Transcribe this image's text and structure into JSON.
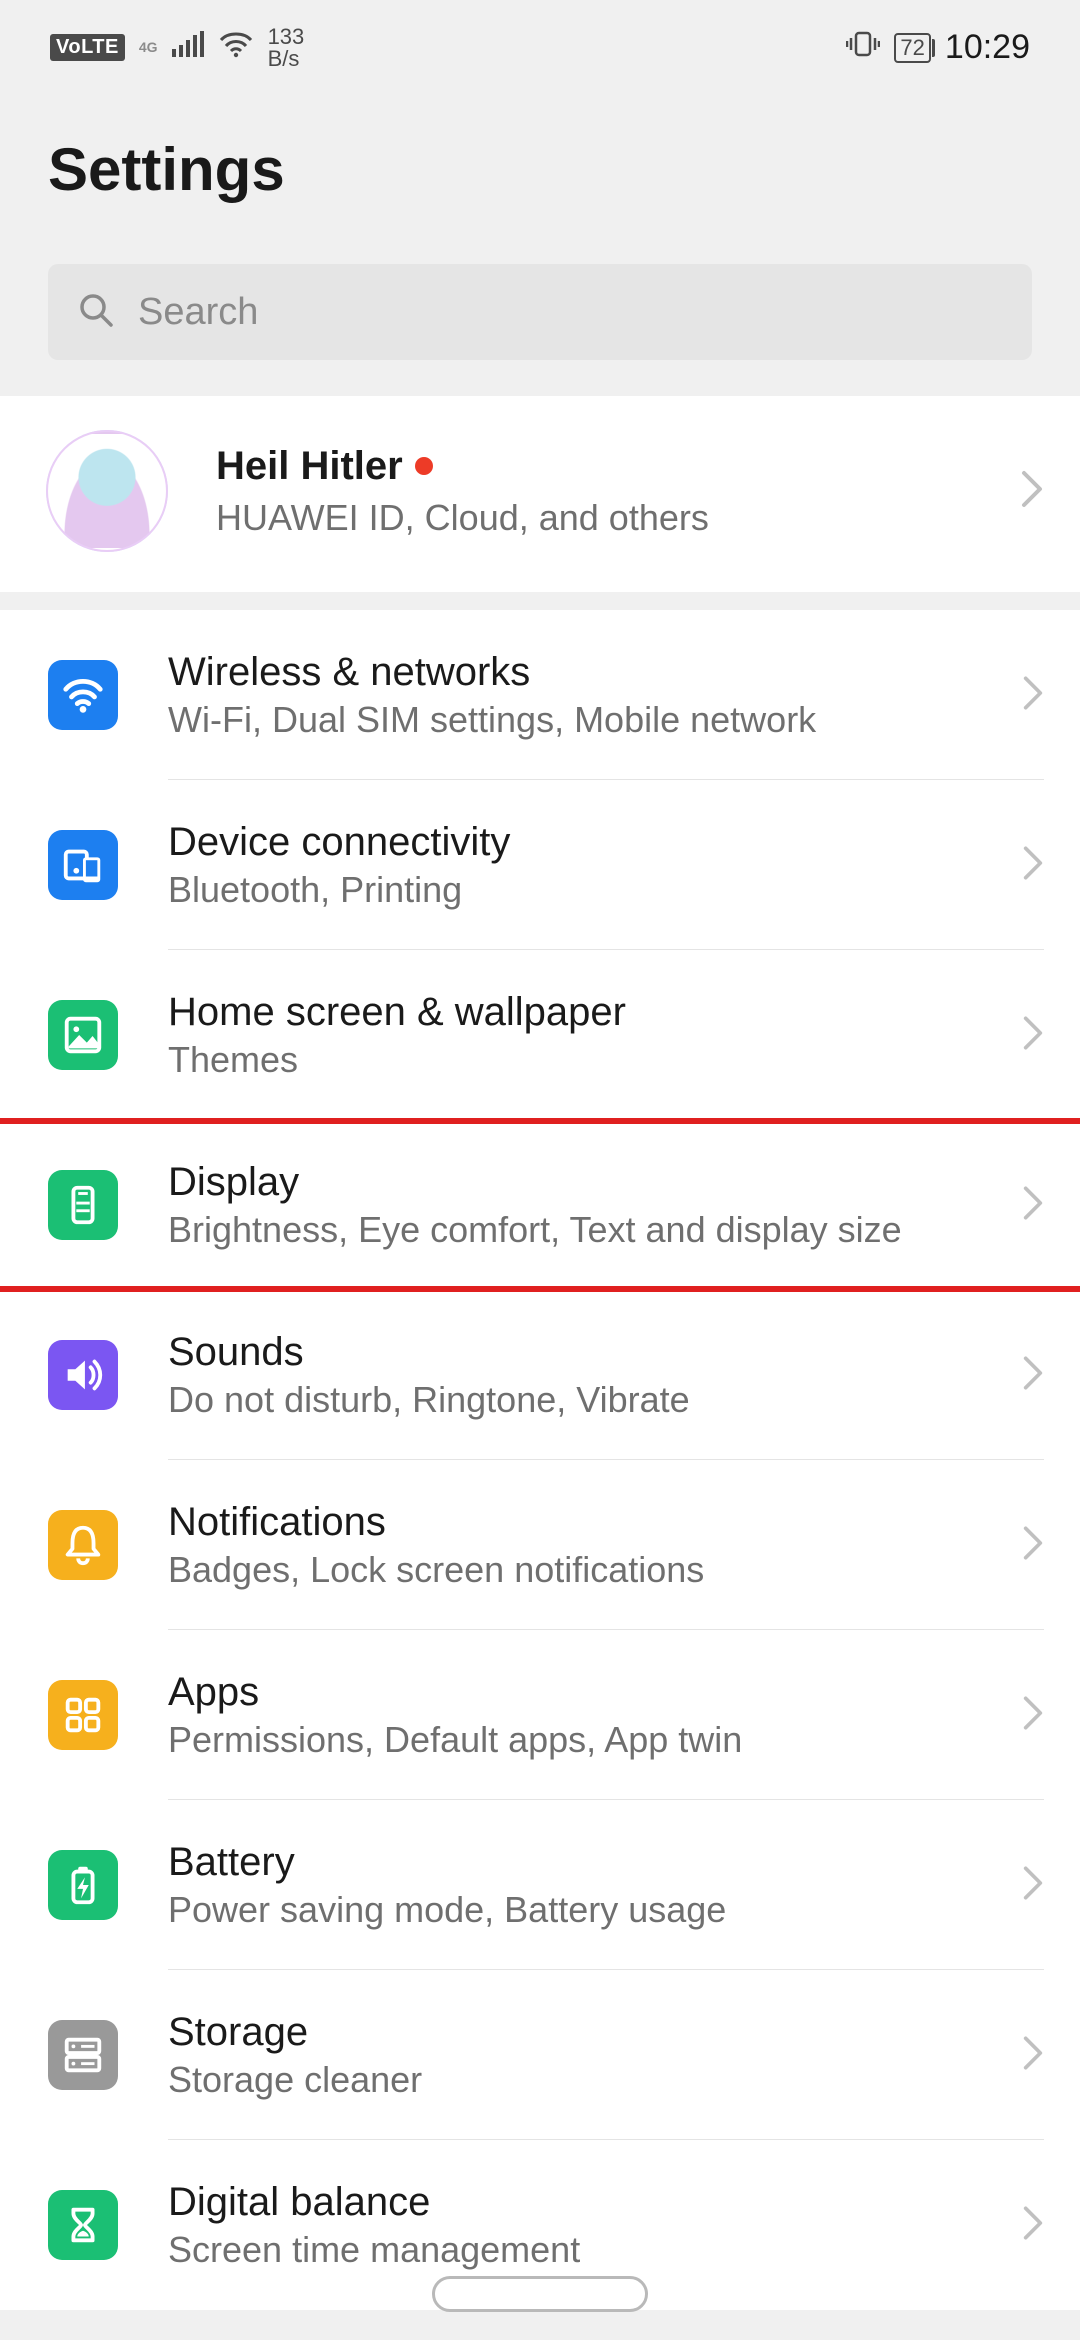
{
  "statusbar": {
    "volte": "VoLTE",
    "net_gen": "4G",
    "speed_value": "133",
    "speed_unit": "B/s",
    "battery_pct": "72",
    "time": "10:29"
  },
  "header": {
    "title": "Settings"
  },
  "search": {
    "placeholder": "Search"
  },
  "account": {
    "name": "Heil Hitler",
    "has_notification": true,
    "subtitle": "HUAWEI ID, Cloud, and others"
  },
  "items": [
    {
      "key": "wireless",
      "title": "Wireless & networks",
      "sub": "Wi-Fi, Dual SIM settings, Mobile network",
      "icon": "wifi",
      "color": "blue"
    },
    {
      "key": "device-connectivity",
      "title": "Device connectivity",
      "sub": "Bluetooth, Printing",
      "icon": "devices",
      "color": "blue"
    },
    {
      "key": "home-wallpaper",
      "title": "Home screen & wallpaper",
      "sub": "Themes",
      "icon": "image",
      "color": "green"
    },
    {
      "key": "display",
      "title": "Display",
      "sub": "Brightness, Eye comfort, Text and display size",
      "icon": "phone",
      "color": "green",
      "highlighted": true
    },
    {
      "key": "sounds",
      "title": "Sounds",
      "sub": "Do not disturb, Ringtone, Vibrate",
      "icon": "speaker",
      "color": "purple"
    },
    {
      "key": "notifications",
      "title": "Notifications",
      "sub": "Badges, Lock screen notifications",
      "icon": "bell",
      "color": "amber"
    },
    {
      "key": "apps",
      "title": "Apps",
      "sub": "Permissions, Default apps, App twin",
      "icon": "grid",
      "color": "amber"
    },
    {
      "key": "battery",
      "title": "Battery",
      "sub": "Power saving mode, Battery usage",
      "icon": "battery",
      "color": "green"
    },
    {
      "key": "storage",
      "title": "Storage",
      "sub": "Storage cleaner",
      "icon": "storage",
      "color": "grey"
    },
    {
      "key": "digital-balance",
      "title": "Digital balance",
      "sub": "Screen time management",
      "icon": "hourglass",
      "color": "green"
    }
  ]
}
